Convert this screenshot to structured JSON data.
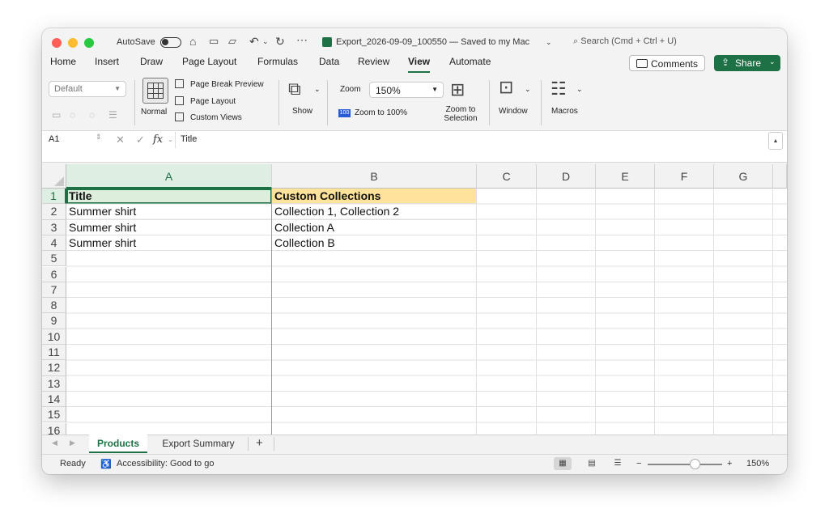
{
  "titlebar": {
    "autosave_label": "AutoSave",
    "file_title": "Export_2026-09-09_100550 — Saved to my Mac",
    "search_placeholder": "Search (Cmd + Ctrl + U)"
  },
  "menu": {
    "tabs": [
      "Home",
      "Insert",
      "Draw",
      "Page Layout",
      "Formulas",
      "Data",
      "Review",
      "View",
      "Automate"
    ],
    "active": "View",
    "comments_label": "Comments",
    "share_label": "Share"
  },
  "ribbon": {
    "style_value": "Default",
    "normal_label": "Normal",
    "page_break_preview": "Page Break Preview",
    "page_layout": "Page Layout",
    "custom_views": "Custom Views",
    "show_label": "Show",
    "zoom_label": "Zoom",
    "zoom_value": "150%",
    "zoom_100_icon_text": "100",
    "zoom_to_100": "Zoom to 100%",
    "zoom_to_selection_line1": "Zoom to",
    "zoom_to_selection_line2": "Selection",
    "window_label": "Window",
    "macros_label": "Macros"
  },
  "formula_bar": {
    "name_box": "A1",
    "fx_label": "fx",
    "formula": "Title"
  },
  "grid": {
    "columns": [
      "A",
      "B",
      "C",
      "D",
      "E",
      "F",
      "G"
    ],
    "row_numbers": [
      "1",
      "2",
      "3",
      "4",
      "5",
      "6",
      "7",
      "8",
      "9",
      "10",
      "11",
      "12",
      "13",
      "14",
      "15",
      "16"
    ],
    "cells": {
      "A1": "Title",
      "B1": "Custom Collections",
      "A2": "Summer shirt",
      "B2": "Collection 1, Collection 2",
      "A3": "Summer shirt",
      "B3": "Collection A",
      "A4": "Summer shirt",
      "B4": "Collection B"
    },
    "selected_cell": "A1",
    "header_fill_a": "#deeedd",
    "header_fill_b": "#ffe39a"
  },
  "sheets": {
    "tabs": [
      "Products",
      "Export Summary"
    ],
    "active": "Products",
    "add_label": "+"
  },
  "status": {
    "ready": "Ready",
    "accessibility": "Accessibility: Good to go",
    "zoom_minus": "−",
    "zoom_plus": "+",
    "zoom_level": "150%",
    "zoom_level_value": 150
  },
  "colors": {
    "accent": "#1e7145",
    "close": "#fe5f57",
    "minimize": "#febc2e",
    "maximize": "#28c840"
  }
}
